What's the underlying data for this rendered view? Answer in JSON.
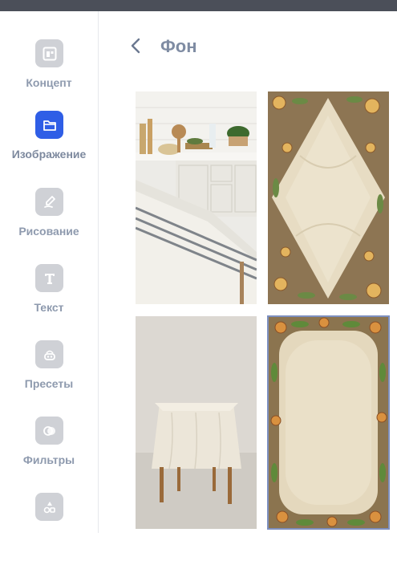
{
  "sidebar": {
    "items": [
      {
        "label": "Концепт",
        "icon": "layout-icon",
        "active": false
      },
      {
        "label": "Изображение",
        "icon": "folder-icon",
        "active": true
      },
      {
        "label": "Рисование",
        "icon": "brush-icon",
        "active": false
      },
      {
        "label": "Текст",
        "icon": "text-icon",
        "active": false
      },
      {
        "label": "Пресеты",
        "icon": "presets-icon",
        "active": false
      },
      {
        "label": "Фильтры",
        "icon": "filters-icon",
        "active": false
      },
      {
        "label": "",
        "icon": "shapes-icon",
        "active": false
      }
    ]
  },
  "header": {
    "title": "Фон",
    "back_icon": "chevron-left-icon"
  },
  "gallery": {
    "tiles": [
      {
        "name": "kitchen-tablecloth-image",
        "selected": false
      },
      {
        "name": "floral-fabric-diamond-image",
        "selected": false
      },
      {
        "name": "draped-table-image",
        "selected": false
      },
      {
        "name": "floral-frame-linen-image",
        "selected": true
      }
    ]
  },
  "colors": {
    "accent": "#2f5ee6",
    "icon_inactive": "#cfd1d6",
    "label": "#8e9aae",
    "title": "#7f8ca3"
  }
}
